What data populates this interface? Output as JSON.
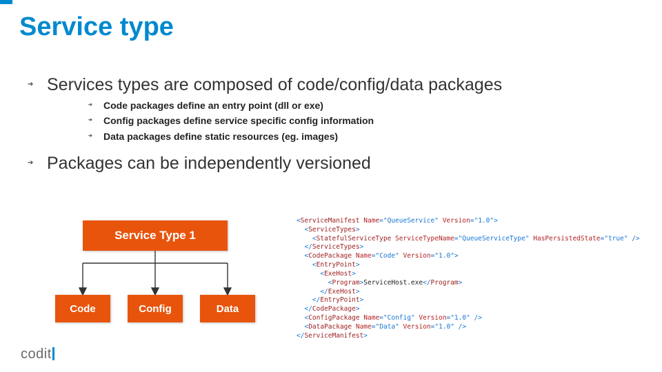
{
  "title": "Service type",
  "bullets": [
    {
      "text": "Services types are composed of code/config/data packages",
      "sub": [
        "Code packages define an entry point (dll or exe)",
        "Config packages define service specific config information",
        "Data packages define static resources (eg. images)"
      ]
    },
    {
      "text": "Packages can be independently versioned",
      "sub": []
    }
  ],
  "diagram": {
    "top": "Service Type 1",
    "bottom": [
      "Code",
      "Config",
      "Data"
    ]
  },
  "xml": {
    "l1a": "ServiceManifest",
    "l1n": "Name",
    "l1nv": "\"QueueService\"",
    "l1v": "Version",
    "l1vv": "\"1.0\"",
    "l2": "ServiceTypes",
    "l3a": "StatefulServiceType",
    "l3n": "ServiceTypeName",
    "l3nv": "\"QueueServiceType\"",
    "l3h": "HasPersistedState",
    "l3hv": "\"true\"",
    "l5a": "CodePackage",
    "l5n": "Name",
    "l5nv": "\"Code\"",
    "l5v": "Version",
    "l5vv": "\"1.0\"",
    "l6": "EntryPoint",
    "l7": "ExeHost",
    "l8": "Program",
    "l8x": "ServiceHost.exe",
    "l12a": "ConfigPackage",
    "l12n": "Name",
    "l12nv": "\"Config\"",
    "l12v": "Version",
    "l12vv": "\"1.0\"",
    "l13a": "DataPackage",
    "l13n": "Name",
    "l13nv": "\"Data\"",
    "l13v": "Version",
    "l13vv": "\"1.0\""
  },
  "logo": "codit"
}
